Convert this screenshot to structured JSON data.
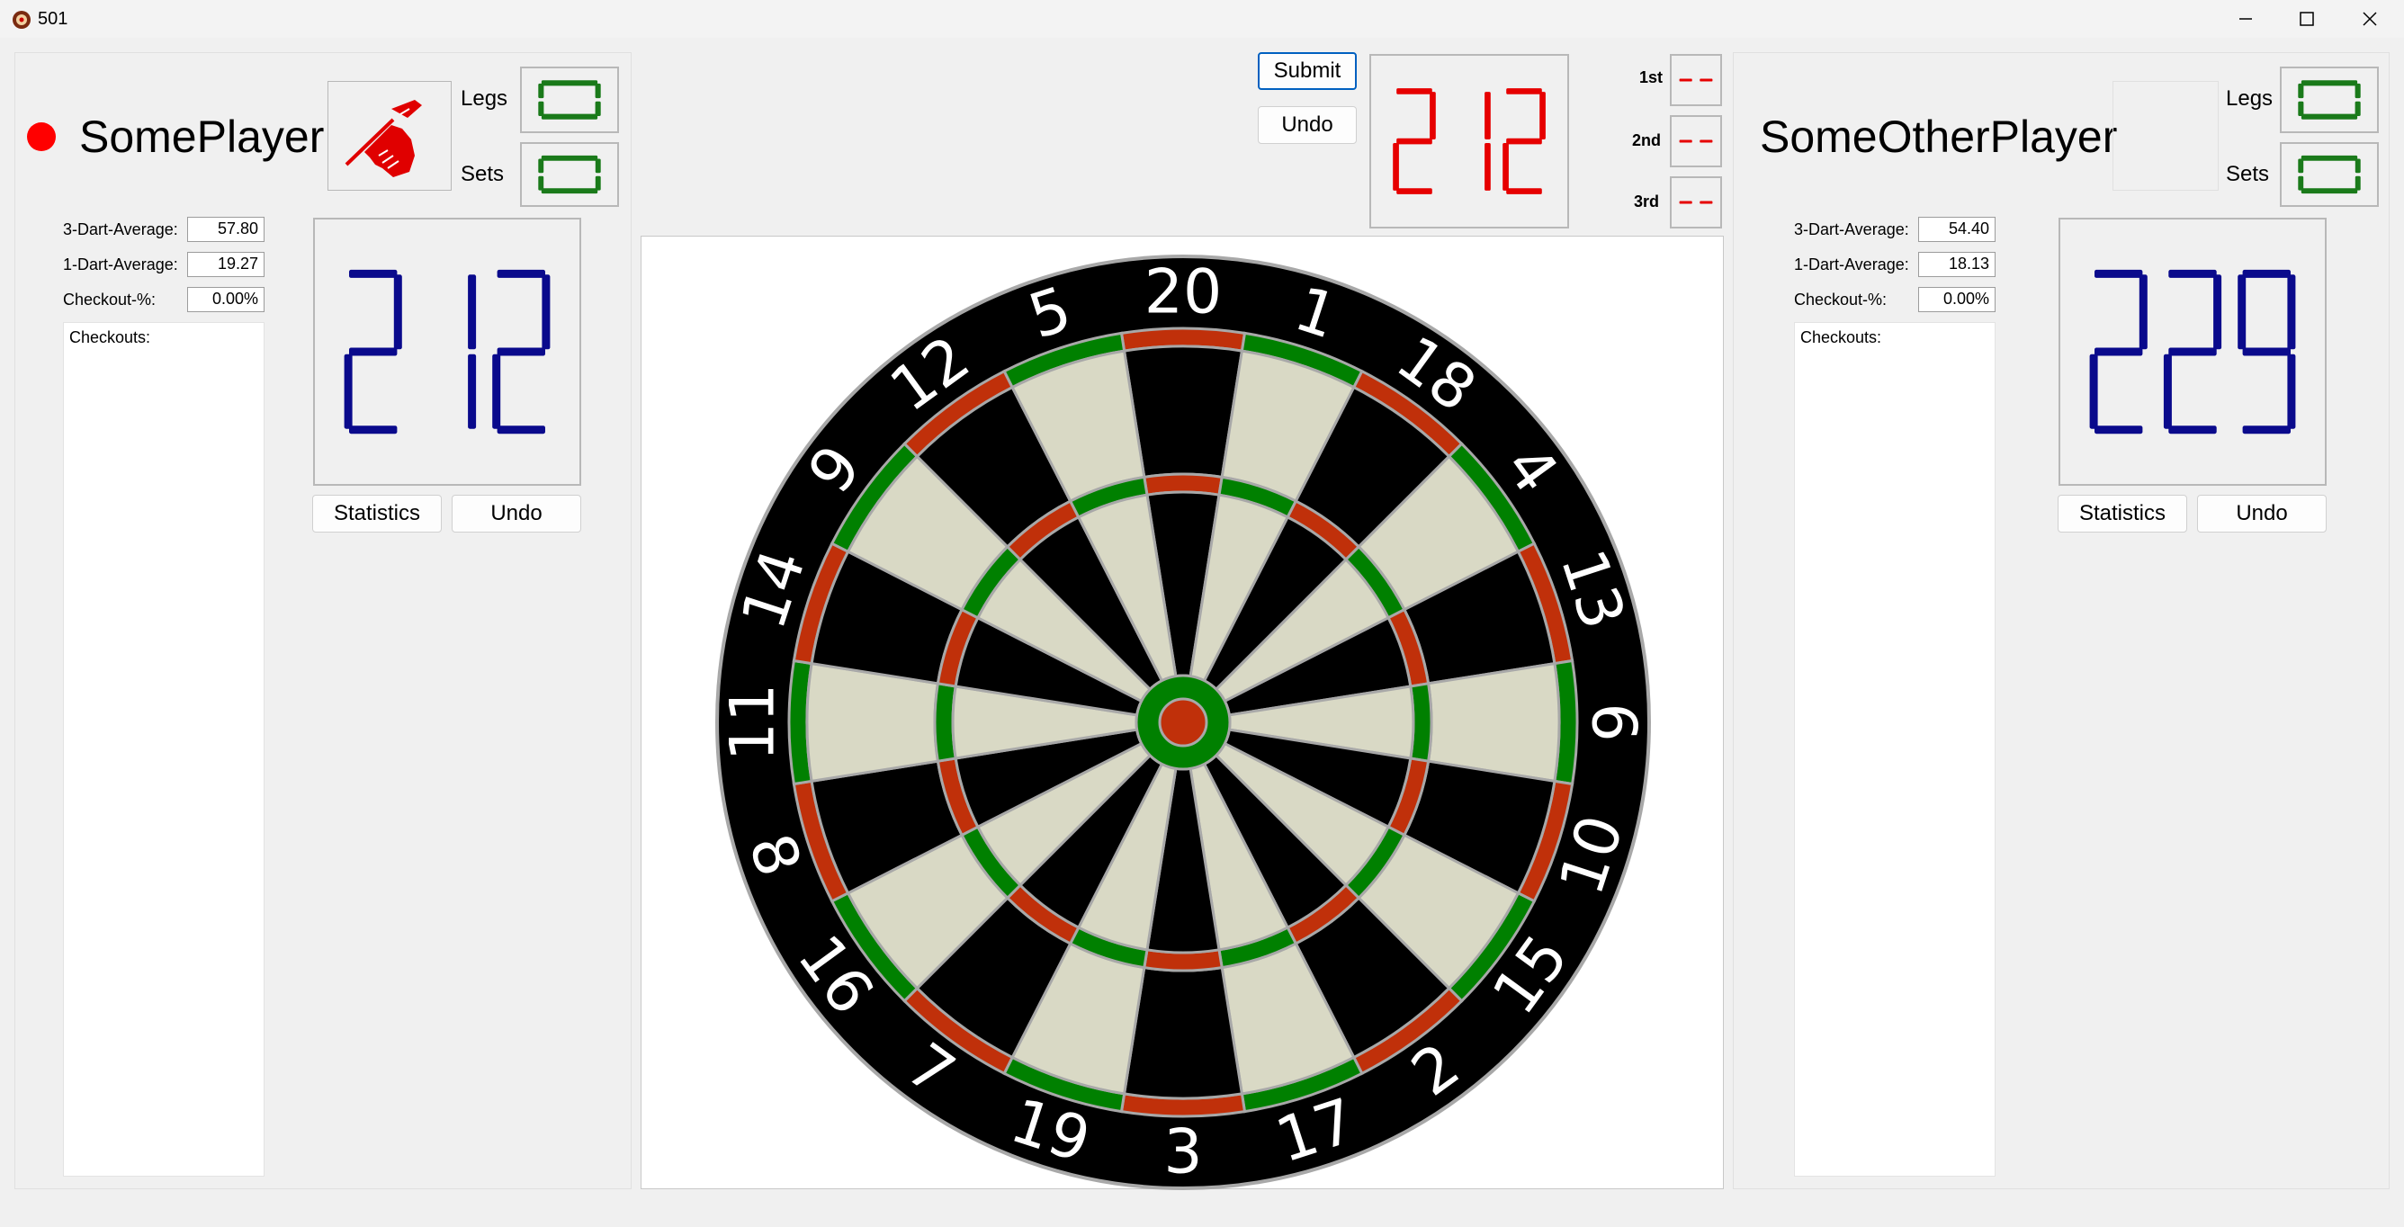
{
  "window": {
    "title": "501"
  },
  "turn": {
    "submit_label": "Submit",
    "undo_label": "Undo",
    "score": "212",
    "throws": [
      {
        "label": "1st",
        "value": "--"
      },
      {
        "label": "2nd",
        "value": "--"
      },
      {
        "label": "3rd",
        "value": "--"
      }
    ]
  },
  "player1": {
    "name": "SomePlayer",
    "active": true,
    "legs_label": "Legs",
    "legs": "0",
    "sets_label": "Sets",
    "sets": "0",
    "avg3_label": "3-Dart-Average:",
    "avg3": "57.80",
    "avg1_label": "1-Dart-Average:",
    "avg1": "19.27",
    "checkout_pct_label": "Checkout-%:",
    "checkout_pct": "0.00%",
    "checkouts_label": "Checkouts:",
    "remaining": "212",
    "stats_label": "Statistics",
    "undo_label": "Undo"
  },
  "player2": {
    "name": "SomeOtherPlayer",
    "active": false,
    "legs_label": "Legs",
    "legs": "0",
    "sets_label": "Sets",
    "sets": "0",
    "avg3_label": "3-Dart-Average:",
    "avg3": "54.40",
    "avg1_label": "1-Dart-Average:",
    "avg1": "18.13",
    "checkout_pct_label": "Checkout-%:",
    "checkout_pct": "0.00%",
    "checkouts_label": "Checkouts:",
    "remaining": "229",
    "stats_label": "Statistics",
    "undo_label": "Undo"
  },
  "dartboard": {
    "numbers": [
      "20",
      "1",
      "18",
      "4",
      "13",
      "6",
      "10",
      "15",
      "2",
      "17",
      "3",
      "19",
      "7",
      "16",
      "8",
      "11",
      "14",
      "9",
      "12",
      "5"
    ]
  },
  "colors": {
    "active_indicator": "#ff0000",
    "player_score": "#0a0a8c",
    "turn_score": "#e60000",
    "legs_sets": "#1a7a1a",
    "board_black": "#000000",
    "board_cream": "#d9d9c5",
    "board_red": "#c0300a",
    "board_green": "#008000",
    "wire": "#a8a8a8"
  },
  "icons": {
    "app": "dart-target-icon",
    "throw_hand": "throwing-hand-icon",
    "minimize": "minimize-icon",
    "maximize": "maximize-icon",
    "close": "close-icon"
  }
}
